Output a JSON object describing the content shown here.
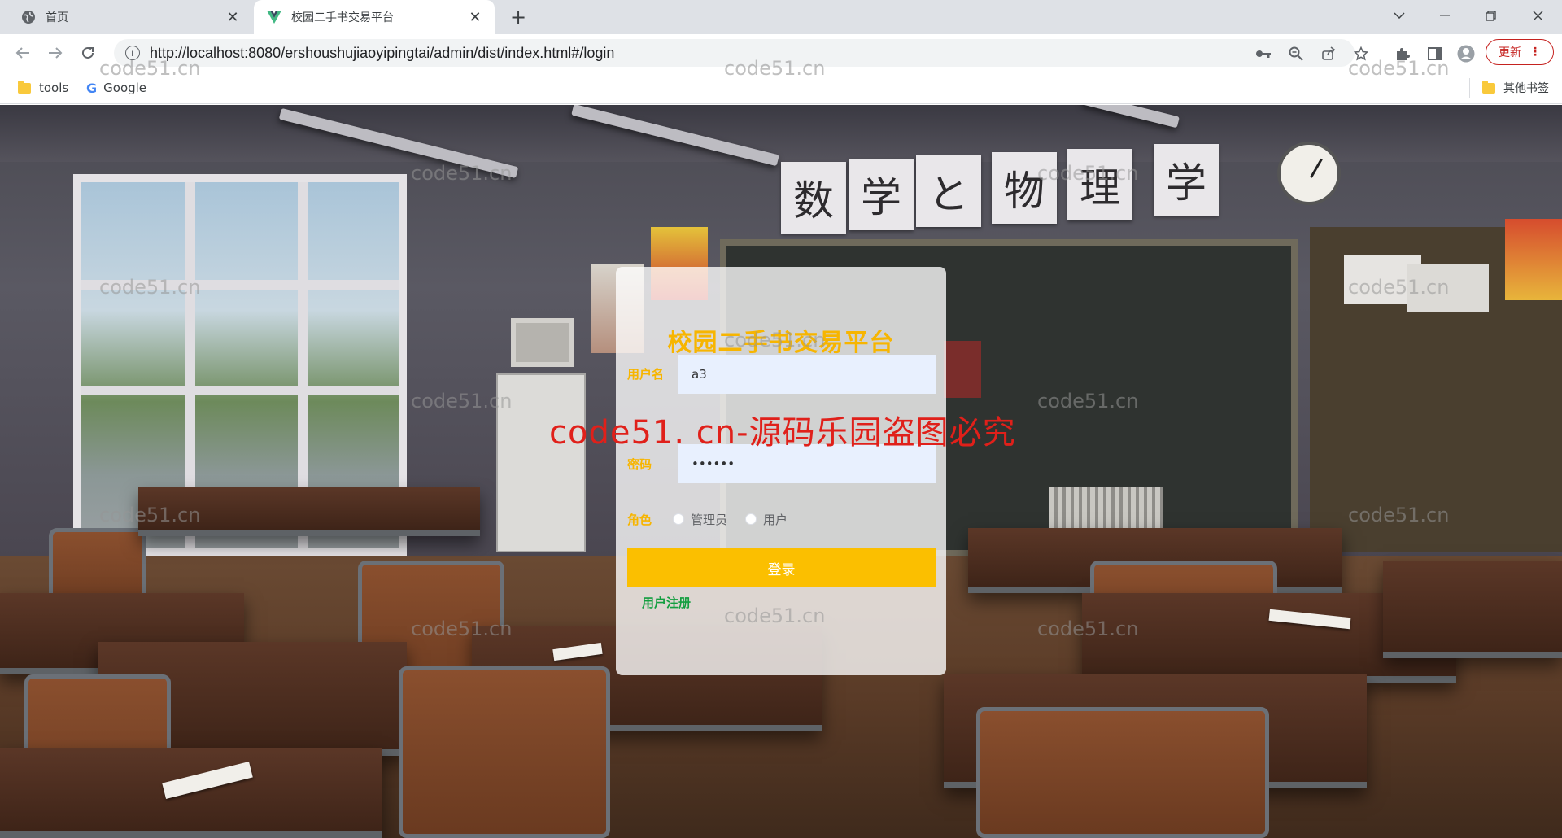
{
  "browser": {
    "tabs": [
      {
        "title": "首页",
        "active": false
      },
      {
        "title": "校园二手书交易平台",
        "active": true
      }
    ],
    "new_tab": "+",
    "url": "http://localhost:8080/ershoushujiaoyipingtai/admin/dist/index.html#/login",
    "update_label": "更新",
    "bookmarks": [
      {
        "label": "tools",
        "icon": "folder-icon"
      },
      {
        "label": "Google",
        "icon": "google-icon"
      }
    ],
    "other_bookmarks": "其他书签"
  },
  "scene": {
    "banner_chars": [
      "数",
      "学",
      "と",
      "物",
      "理",
      "学"
    ]
  },
  "login": {
    "title": "校园二手书交易平台",
    "username_label": "用户名",
    "username_value": "a3",
    "password_label": "密码",
    "password_value": "••••••",
    "role_label": "角色",
    "roles": [
      "管理员",
      "用户"
    ],
    "login_button": "登录",
    "register_link": "用户注册"
  },
  "watermarks": {
    "small": "code51.cn",
    "big": "code51. cn-源码乐园盗图必究"
  },
  "colors": {
    "accent": "#f7b500",
    "button": "#fbbf00",
    "register": "#129e3f",
    "watermark_red": "#e0201a"
  }
}
